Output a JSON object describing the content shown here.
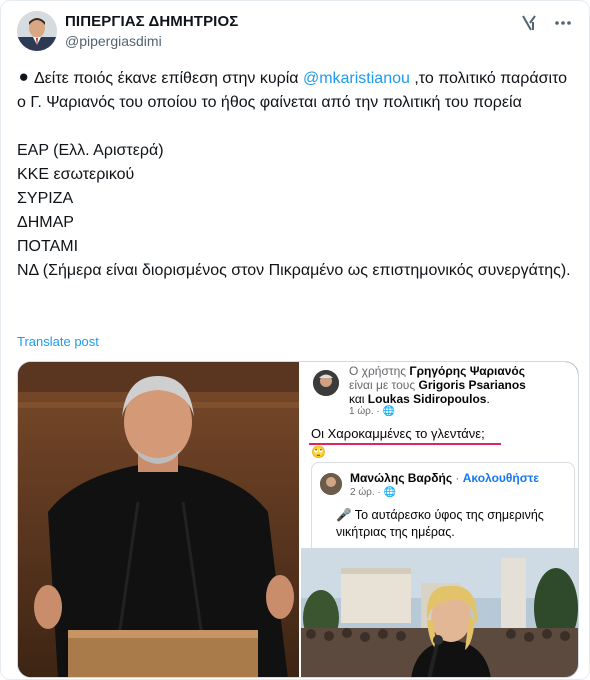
{
  "author": {
    "display_name": "ΠΙΠΕΡΓΙΑΣ ΔΗΜΗΤΡΙΟΣ",
    "handle": "@pipergiasdimi"
  },
  "tweet": {
    "line1_prefix": "⚫ Δείτε ποιός έκανε επίθεση στην κυρία ",
    "mention": "@mkaristianou",
    "line1_suffix": " ,το πολιτικό παράσιτο ο  Γ. Ψαριανός του οποίου το ήθος φαίνεται από την πολιτική του πορεία",
    "parties": [
      "ΕΑΡ (Ελλ. Αριστερά)",
      "ΚΚΕ εσωτερικού",
      "ΣΥΡΙΖΑ",
      "ΔΗΜΑΡ",
      "ΠΟΤΑΜΙ",
      "ΝΔ  (Σήμερα είναι διορισμένος στον Πικραμένο ως επιστημονικός συνεργάτης)."
    ]
  },
  "translate_label": "Translate post",
  "icons": {
    "grok": "grok-icon",
    "more": "more-icon"
  },
  "media": {
    "fb_post": {
      "line1": "Ο χρήστης ",
      "line1_name": "Γρηγόρης Ψαριανός",
      "line2": "είναι με τους ",
      "line2_name": "Grigoris Psarianos",
      "line3_pre": "και ",
      "line3_name": "Loukas Sidiropoulos",
      "line3_post": ".",
      "time": "1 ώρ. · ",
      "body": "Οι Χαροκαμμένες το γλεντάνε;",
      "emoji": "🙄",
      "shared_name": "Μανώλης Βαρδής",
      "shared_sep": " · ",
      "shared_follow": "Ακολουθήστε",
      "shared_time": "2 ώρ. · ",
      "shared_text": "🎤 Το αυτάρεσκο ύφος της σημερινής νικήτριας της ημέρας."
    }
  }
}
